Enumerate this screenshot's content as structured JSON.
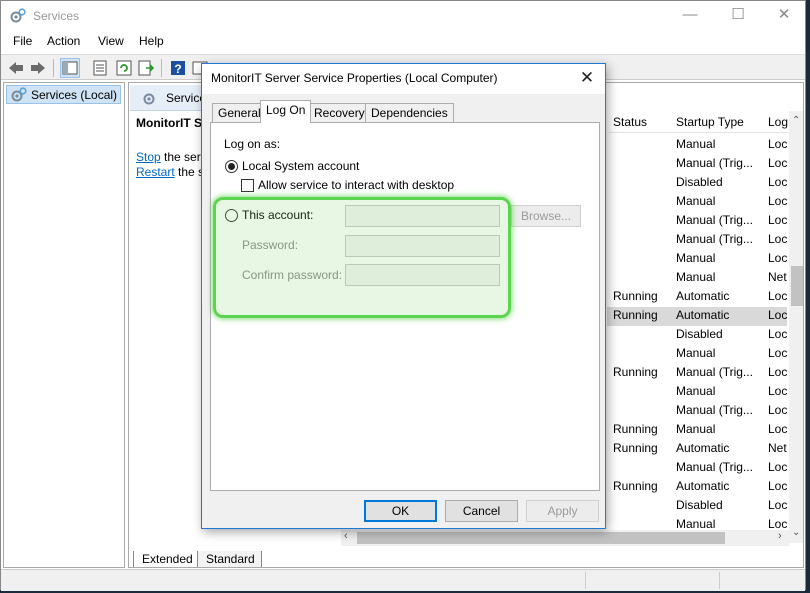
{
  "window": {
    "title": "Services",
    "controls": [
      "—",
      "☐",
      "✕"
    ]
  },
  "menu": [
    "File",
    "Action",
    "View",
    "Help"
  ],
  "tree": {
    "item": "Services (Local)"
  },
  "pane": {
    "header": "Services",
    "selected_name": "MonitorIT S",
    "stop_link": "Stop",
    "stop_rest": " the serv",
    "restart_link": "Restart",
    "restart_rest": " the se"
  },
  "columns": {
    "status": "Status",
    "startup": "Startup Type",
    "logon": "Log"
  },
  "rows": [
    {
      "status": "",
      "startup": "Manual",
      "logon": "Loc"
    },
    {
      "status": "",
      "startup": "Manual (Trig...",
      "logon": "Loc"
    },
    {
      "status": "",
      "startup": "Disabled",
      "logon": "Loc"
    },
    {
      "status": "",
      "startup": "Manual",
      "logon": "Loc"
    },
    {
      "status": "",
      "startup": "Manual (Trig...",
      "logon": "Loc"
    },
    {
      "status": "",
      "startup": "Manual (Trig...",
      "logon": "Loc"
    },
    {
      "status": "",
      "startup": "Manual",
      "logon": "Loc"
    },
    {
      "status": "",
      "startup": "Manual",
      "logon": "Net"
    },
    {
      "status": "Running",
      "startup": "Automatic",
      "logon": "Loc"
    },
    {
      "status": "Running",
      "startup": "Automatic",
      "logon": "Loc"
    },
    {
      "status": "",
      "startup": "Disabled",
      "logon": "Loc"
    },
    {
      "status": "",
      "startup": "Manual",
      "logon": "Loc"
    },
    {
      "status": "Running",
      "startup": "Manual (Trig...",
      "logon": "Loc"
    },
    {
      "status": "",
      "startup": "Manual",
      "logon": "Loc"
    },
    {
      "status": "",
      "startup": "Manual (Trig...",
      "logon": "Loc"
    },
    {
      "status": "Running",
      "startup": "Manual",
      "logon": "Loc"
    },
    {
      "status": "Running",
      "startup": "Automatic",
      "logon": "Net"
    },
    {
      "status": "",
      "startup": "Manual (Trig...",
      "logon": "Loc"
    },
    {
      "status": "Running",
      "startup": "Automatic",
      "logon": "Loc"
    },
    {
      "status": "",
      "startup": "Disabled",
      "logon": "Loc"
    },
    {
      "status": "",
      "startup": "Manual",
      "logon": "Loc"
    }
  ],
  "bottom_tabs": [
    "Extended",
    "Standard"
  ],
  "dialog": {
    "title": "MonitorIT Server Service Properties (Local Computer)",
    "tabs": [
      "General",
      "Log On",
      "Recovery",
      "Dependencies"
    ],
    "active_tab": "Log On",
    "logon_as": "Log on as:",
    "local_system": "Local System account",
    "allow_interact": "Allow service to interact with desktop",
    "this_account": "This account:",
    "password": "Password:",
    "confirm_password": "Confirm password:",
    "browse": "Browse...",
    "ok": "OK",
    "cancel": "Cancel",
    "apply": "Apply"
  },
  "colors": {
    "highlight": "#5bd44e",
    "accent": "#0078d7",
    "link": "#0066cc"
  }
}
